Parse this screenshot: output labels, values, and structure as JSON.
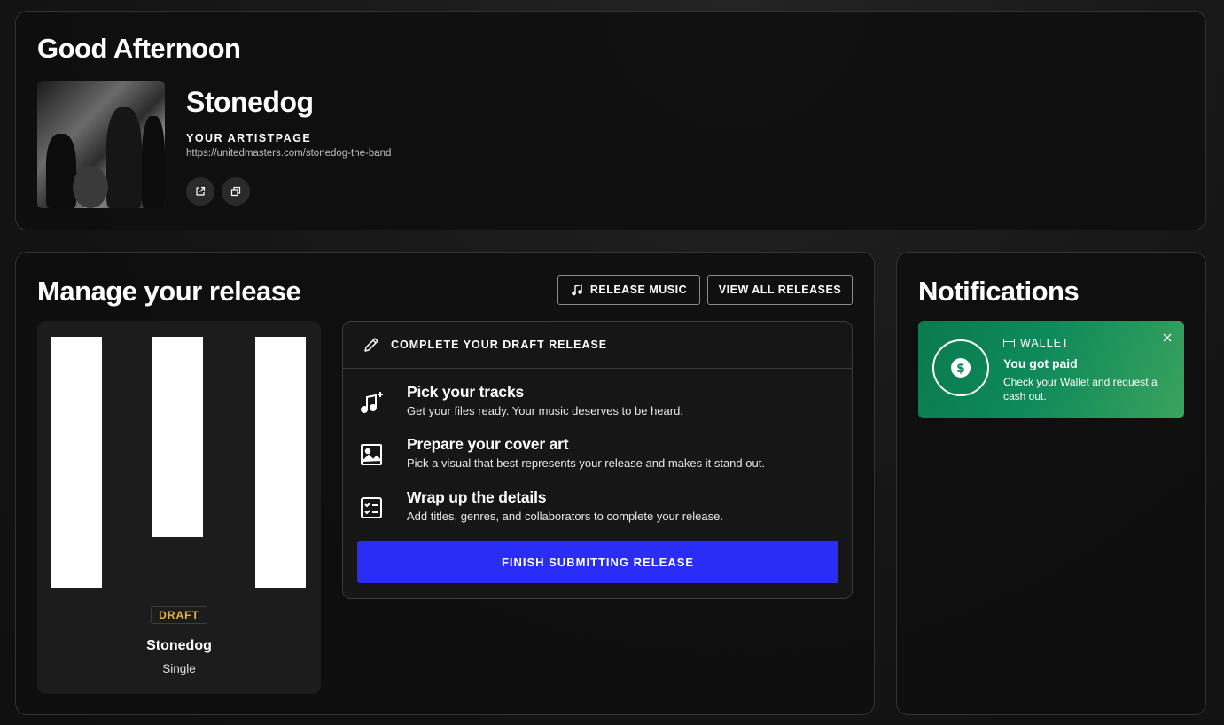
{
  "greeting": {
    "title": "Good Afternoon",
    "artist_name": "Stonedog",
    "artistpage_label": "YOUR ARTISTPAGE",
    "artistpage_url": "https://unitedmasters.com/stonedog-the-band",
    "photo": "band-photo-image",
    "actions": [
      {
        "icon": "external-link-icon"
      },
      {
        "icon": "copy-icon"
      }
    ]
  },
  "release": {
    "title": "Manage your release",
    "release_music_label": "RELEASE MUSIC",
    "release_music_icon": "music-note-icon",
    "view_all_label": "VIEW ALL RELEASES",
    "tile": {
      "badge": "DRAFT",
      "badge_color": "#e8b53a",
      "name": "Stonedog",
      "type": "Single"
    },
    "draft_panel": {
      "header_icon": "pencil-icon",
      "header": "COMPLETE YOUR DRAFT RELEASE",
      "steps": [
        {
          "icon": "music-plus-icon",
          "title": "Pick your tracks",
          "desc": "Get your files ready. Your music deserves to be heard."
        },
        {
          "icon": "image-icon",
          "title": "Prepare your cover art",
          "desc": "Pick a visual that best represents your release and makes it stand out."
        },
        {
          "icon": "checklist-icon",
          "title": "Wrap up the details",
          "desc": "Add titles, genres, and collaborators to complete your release."
        }
      ],
      "finish_label": "FINISH SUBMITTING RELEASE",
      "finish_color": "#2a2df5"
    }
  },
  "notifications": {
    "title": "Notifications",
    "items": [
      {
        "icon": "dollar-icon",
        "label_icon": "wallet-icon",
        "label": "WALLET",
        "headline": "You got paid",
        "body": "Check your Wallet and request a cash out.",
        "close_icon": "close-icon",
        "color": "#0e8a5a"
      }
    ]
  }
}
